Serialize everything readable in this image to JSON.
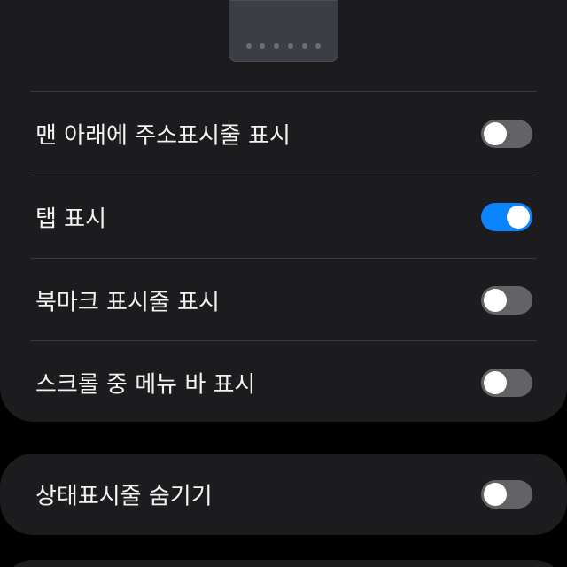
{
  "settings": {
    "items": [
      {
        "label": "맨 아래에 주소표시줄 표시",
        "enabled": false
      },
      {
        "label": "탭 표시",
        "enabled": true
      },
      {
        "label": "북마크 표시줄 표시",
        "enabled": false
      },
      {
        "label": "스크롤 중 메뉴 바 표시",
        "enabled": false
      }
    ],
    "status_bar_item": {
      "label": "상태표시줄 숨기기",
      "enabled": false
    }
  },
  "colors": {
    "background": "#000000",
    "card": "#1c1c1e",
    "toggle_on": "#0a84ff",
    "toggle_off": "#636366",
    "text": "#f2f2f2"
  },
  "icons": {
    "preview": "browser-layout-preview-icon"
  }
}
